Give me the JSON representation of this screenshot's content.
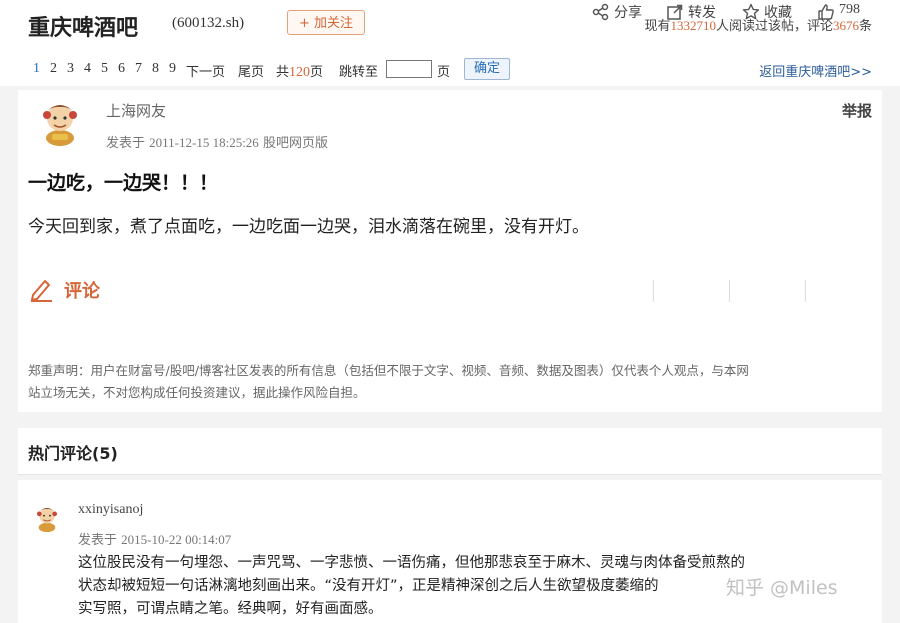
{
  "header": {
    "forum_title": "重庆啤酒吧",
    "stock_code": "(600132.sh)",
    "follow_button": "+ 加关注",
    "stats_prefix": "现有",
    "read_count": "1332710",
    "stats_middle": "人阅读过该帖，评论",
    "comment_count": "3676",
    "stats_suffix": "条"
  },
  "pagination": {
    "pages": [
      "1",
      "2",
      "3",
      "4",
      "5",
      "6",
      "7",
      "8",
      "9"
    ],
    "current": "1",
    "next_label": "下一页",
    "last_label": "尾页",
    "total_prefix": "共",
    "total_pages": "120",
    "total_suffix": "页",
    "jump_label": "跳转至",
    "page_suffix": "页",
    "confirm_label": "确定",
    "back_link": "返回重庆啤酒吧>>"
  },
  "post": {
    "author": "上海网友",
    "meta_prefix": "发表于",
    "timestamp": "2011-12-15 18:25:26",
    "source": "股吧网页版",
    "report_label": "举报",
    "title": "一边吃，一边哭！！！",
    "body": "今天回到家，煮了点面吃，一边吃面一边哭，泪水滴落在碗里，没有开灯。",
    "comment_label": "评论",
    "share_label": "分享",
    "repost_label": "转发",
    "favorite_label": "收藏",
    "like_count": "798",
    "disclaimer_line1": "郑重声明：用户在财富号/股吧/博客社区发表的所有信息（包括但不限于文字、视频、音频、数据及图表）仅代表个人观点，与本网",
    "disclaimer_line2": "站立场无关，不对您构成任何投资建议，据此操作风险自担。"
  },
  "hot_comments": {
    "title": "热门评论(5)",
    "items": [
      {
        "author": "xxinyisanoj",
        "meta_prefix": "发表于",
        "timestamp": "2015-10-22 00:14:07",
        "line1": "这位股民没有一句埋怨、一声咒骂、一字悲愤、一语伤痛，但他那悲哀至于麻木、灵魂与肉体备受煎熬的",
        "line2": "状态却被短短一句话淋漓地刻画出来。“没有开灯”，正是精神深创之后人生欲望极度萎缩的",
        "line3": "实写照，可谓点睛之笔。经典啊，好有画面感。"
      }
    ]
  },
  "watermark": "知乎 @Miles",
  "colors": {
    "accent": "#d6663a",
    "link": "#2a6db8",
    "background": "#f3f3f3"
  },
  "icons": [
    "pencil-icon",
    "share-icon",
    "repost-icon",
    "star-icon",
    "thumbs-up-icon",
    "avatar"
  ]
}
